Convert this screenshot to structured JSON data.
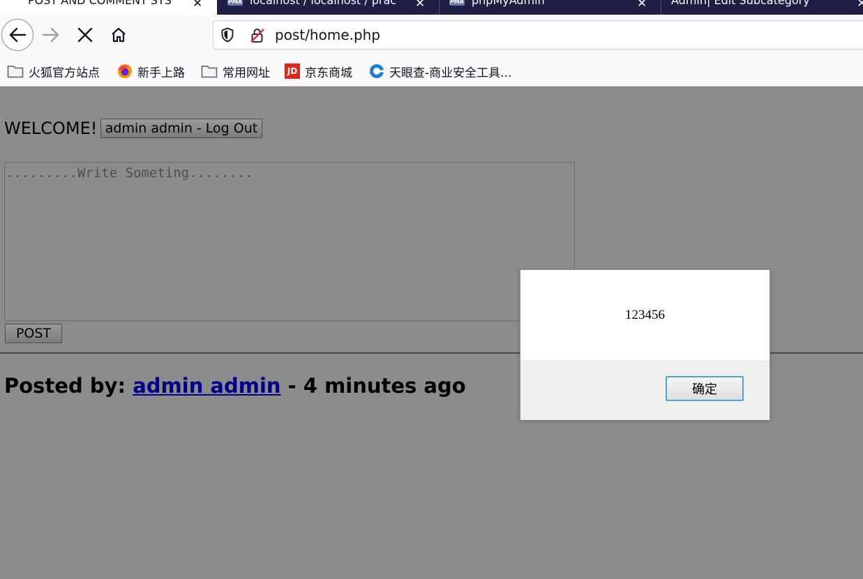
{
  "browser": {
    "tabs": [
      {
        "title": "POST AND COMMENT SYS",
        "active": true
      },
      {
        "title": "localhost / localhost / prac",
        "icon": "pma-icon"
      },
      {
        "title": "phpMyAdmin",
        "icon": "pma-icon"
      },
      {
        "title": "Admin| Edit Subcategory"
      }
    ],
    "pma_badge": "PMA",
    "close_glyph": "✕",
    "url": "post/home.php",
    "bookmarks": [
      {
        "label": "火狐官方站点",
        "icon": "folder-icon"
      },
      {
        "label": "新手上路",
        "icon": "firefox-icon"
      },
      {
        "label": "常用网址",
        "icon": "folder-icon"
      },
      {
        "label": "京东商城",
        "icon": "jd-icon",
        "badge": "JD"
      },
      {
        "label": "天眼查-商业安全工具...",
        "icon": "tianyancha-icon"
      }
    ]
  },
  "page": {
    "welcome": "WELCOME!",
    "logout_button": "admin admin - Log Out",
    "post_placeholder": ".........Write Someting........",
    "post_button": "POST",
    "posted_by_label": "Posted by:",
    "author": "admin admin",
    "time_suffix": " - 4 minutes ago"
  },
  "dialog": {
    "message": "123456",
    "ok_button": "确定"
  },
  "colors": {
    "overlay_background": "#8c8c8c",
    "tabstrip": "#1f1e44",
    "link": "#00008b",
    "focus_ring": "#4da3d8"
  }
}
